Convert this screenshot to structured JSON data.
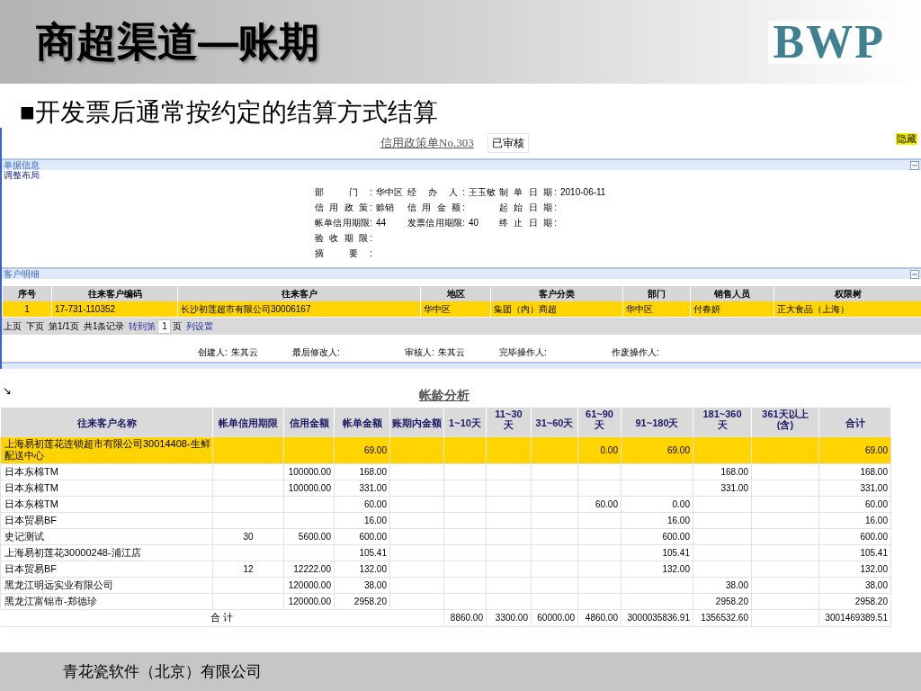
{
  "slide": {
    "title": "商超渠道—账期",
    "logo": "BWP",
    "bullet": "■开发票后通常按约定的结算方式结算",
    "footer": "青花瓷软件（北京）有限公司"
  },
  "document": {
    "title": "信用政策单No.303",
    "status": "已审核",
    "hide_button": "隐藏",
    "info_section": {
      "title": "单据信息",
      "expanded": true,
      "layout_link": "调整布局",
      "fields": [
        [
          {
            "label": "部 门:",
            "value": "华中区"
          },
          {
            "label": "经 办 人:",
            "value": "王玉敏"
          },
          {
            "label": "制 单 日 期:",
            "value": "2010-06-11"
          }
        ],
        [
          {
            "label": "信 用 政 策:",
            "value": "赊销"
          },
          {
            "label": "信 用 金 额:"
          },
          {
            "label": "起 始 日 期:"
          }
        ],
        [
          {
            "label": "帐单信用期限:",
            "value": "44"
          },
          {
            "label": "发票信用期限:",
            "value": "40"
          },
          {
            "label": "终 止 日 期:"
          }
        ],
        [
          {
            "label": "验 收 期 限:"
          }
        ],
        [
          {
            "label": "摘 要:"
          }
        ]
      ]
    },
    "customer_section": {
      "title": "客户明细",
      "expanded": true,
      "columns": [
        "序号",
        "往来客户编码",
        "往来客户",
        "地区",
        "客户分类",
        "部门",
        "销售人员",
        "权限树"
      ],
      "rows": [
        {
          "selected": true,
          "cells": [
            "1",
            "17-731-110352",
            "长沙初莲超市有限公司30006167",
            "华中区",
            "集团（内）商超",
            "华中区",
            "付春妍",
            "正大食品（上海）"
          ]
        }
      ],
      "pager": {
        "prev": "上页",
        "next": "下页",
        "page_info": "第1/1页",
        "record_count": "共1条记录",
        "goto_label": "转到第",
        "goto_value": "1",
        "goto_suffix": "页",
        "column_settings": "列设置"
      }
    },
    "audit": [
      {
        "label": "创建人:",
        "value": "朱其云"
      },
      {
        "label": "最后修改人:"
      },
      {
        "label": "审核人:",
        "value": "朱其云"
      },
      {
        "label": "完毕操作人:"
      },
      {
        "label": "作废操作人:"
      }
    ]
  },
  "aging": {
    "arrow": "↘",
    "title": "帐龄分析",
    "columns": [
      "往来客户名称",
      "帐单信用期限",
      "信用金额",
      "帐单金额",
      "账期内金额",
      "1~10天",
      "11~30天",
      "31~60天",
      "61~90天",
      "91~180天",
      "181~360天",
      "361天以上(含)",
      "合计"
    ],
    "rows": [
      {
        "selected": true,
        "cells": [
          "上海易初莲花连锁超市有限公司30014408-生鲜配送中心",
          null,
          null,
          "69.00",
          null,
          null,
          null,
          null,
          "0.00",
          "69.00",
          null,
          null,
          "69.00"
        ]
      },
      {
        "selected": false,
        "cells": [
          "日本东棉TM",
          null,
          "100000.00",
          "168.00",
          null,
          null,
          null,
          null,
          null,
          null,
          "168.00",
          null,
          "168.00"
        ]
      },
      {
        "selected": false,
        "cells": [
          "日本东棉TM",
          null,
          "100000.00",
          "331.00",
          null,
          null,
          null,
          null,
          null,
          null,
          "331.00",
          null,
          "331.00"
        ]
      },
      {
        "selected": false,
        "cells": [
          "日本东棉TM",
          null,
          null,
          "60.00",
          null,
          null,
          null,
          null,
          "60.00",
          "0.00",
          null,
          null,
          "60.00"
        ]
      },
      {
        "selected": false,
        "cells": [
          "日本贸易BF",
          null,
          null,
          "16.00",
          null,
          null,
          null,
          null,
          null,
          "16.00",
          null,
          null,
          "16.00"
        ]
      },
      {
        "selected": false,
        "cells": [
          "史记测试",
          "30",
          "5600.00",
          "600.00",
          null,
          null,
          null,
          null,
          null,
          "600.00",
          null,
          null,
          "600.00"
        ]
      },
      {
        "selected": false,
        "cells": [
          "上海易初莲花30000248-浦江店",
          null,
          null,
          "105.41",
          null,
          null,
          null,
          null,
          null,
          "105.41",
          null,
          null,
          "105.41"
        ]
      },
      {
        "selected": false,
        "cells": [
          "日本贸易BF",
          "12",
          "12222.00",
          "132.00",
          null,
          null,
          null,
          null,
          null,
          "132.00",
          null,
          null,
          "132.00"
        ]
      },
      {
        "selected": false,
        "cells": [
          "黑龙江明远实业有限公司",
          null,
          "120000.00",
          "38.00",
          null,
          null,
          null,
          null,
          null,
          null,
          "38.00",
          null,
          "38.00"
        ]
      },
      {
        "selected": false,
        "cells": [
          "黑龙江富锦市-郑德珍",
          null,
          "120000.00",
          "2958.20",
          null,
          null,
          null,
          null,
          null,
          null,
          "2958.20",
          null,
          "2958.20"
        ]
      }
    ],
    "total": {
      "label": "合 计",
      "cells": [
        "8860.00",
        "3300.00",
        "60000.00",
        "4860.00",
        "3000035836.91",
        "1356532.60",
        null,
        "3001469389.51"
      ]
    }
  }
}
